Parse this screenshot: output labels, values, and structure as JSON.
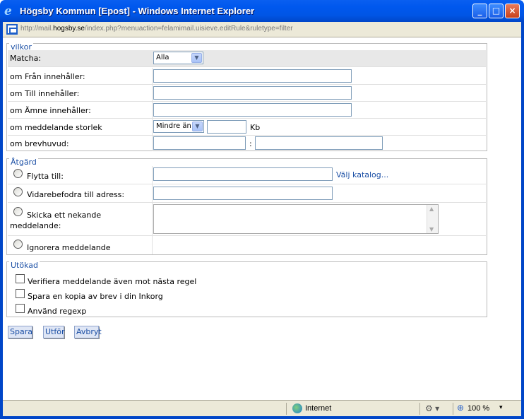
{
  "window": {
    "title": "Högsby Kommun [Epost] - Windows Internet Explorer",
    "icon": "ie-icon",
    "minimize_glyph": "_",
    "maximize_glyph": "□",
    "close_glyph": "×"
  },
  "address": {
    "prefix": "http://mail.",
    "host": "hogsby.se",
    "path": "/index.php?menuaction=felamimail.uisieve.editRule&ruletype=filter"
  },
  "vilkor": {
    "legend": "vilkor",
    "match_label": "Matcha:",
    "match_value": "Alla",
    "from_label": "om Från innehåller:",
    "to_label": "om Till innehåller:",
    "subject_label": "om Ämne innehåller:",
    "size_label": "om meddelande storlek",
    "size_select_value": "Mindre än",
    "size_unit": "Kb",
    "header_label": "om brevhuvud:",
    "header_sep": ":"
  },
  "atgard": {
    "legend": "Åtgärd",
    "move_label": "Flytta till:",
    "choose_folder": "Välj katalog...",
    "forward_label": "Vidarebefodra till adress:",
    "reject_label_1": "Skicka ett nekande",
    "reject_label_2": "meddelande:",
    "discard_label": "Ignorera meddelande"
  },
  "utokad": {
    "legend": "Utökad",
    "verify_label": "Verifiera meddelande även mot nästa regel",
    "copy_label": "Spara en kopia av brev i din Inkorg",
    "regexp_label": "Använd regexp"
  },
  "buttons": {
    "save": "Spara",
    "apply": "Utför",
    "cancel": "Avbryt"
  },
  "status": {
    "zone": "Internet",
    "zoom": "100 %"
  }
}
